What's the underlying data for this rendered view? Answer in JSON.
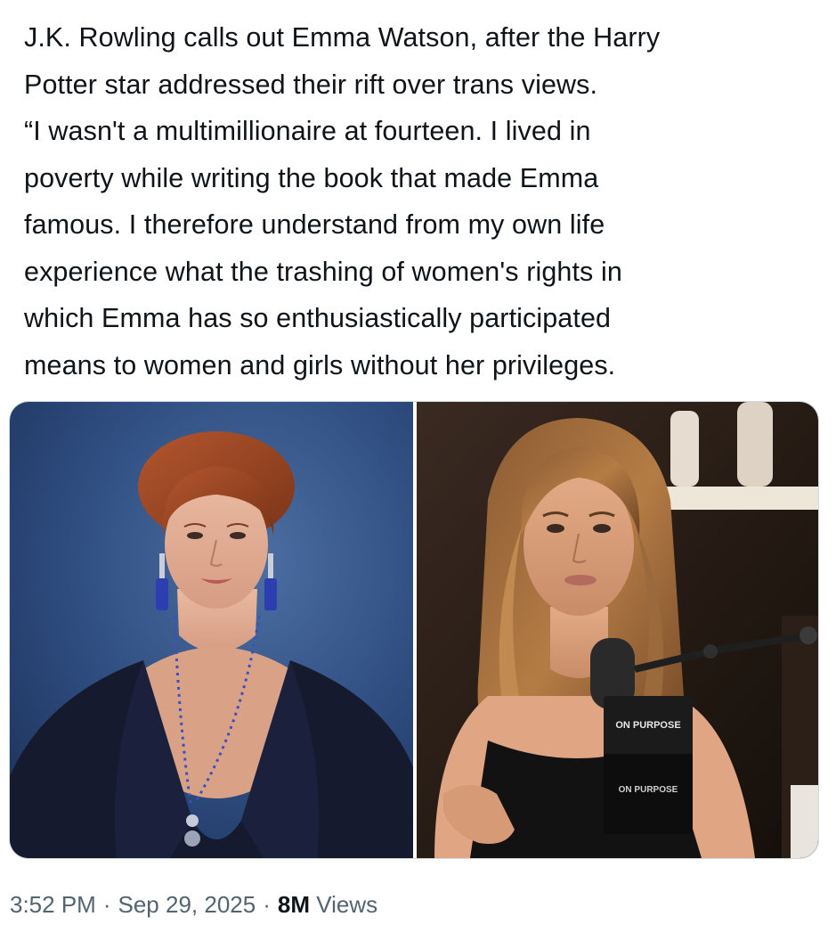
{
  "tweet": {
    "lines": [
      "J.K. Rowling calls out Emma Watson, after the Harry",
      "Potter star addressed their rift over trans views.",
      "“I wasn't a multimillionaire at fourteen. I lived in",
      "poverty while writing the book that made Emma",
      "famous. I therefore understand from my own life",
      "experience what the trashing of women's rights in",
      "which Emma has so enthusiastically participated",
      "means to women and girls without her privileges."
    ]
  },
  "media": {
    "right_photo": {
      "mic_brand_text_1": "ON PURPOSE",
      "mic_brand_text_2": "ON PURPOSE"
    }
  },
  "meta": {
    "time": "3:52 PM",
    "separator": "·",
    "date": "Sep 29, 2025",
    "views_count": "8M",
    "views_label": "Views"
  },
  "colors": {
    "text": "#0f1419",
    "secondary": "#536471",
    "border": "#cfd9de"
  }
}
